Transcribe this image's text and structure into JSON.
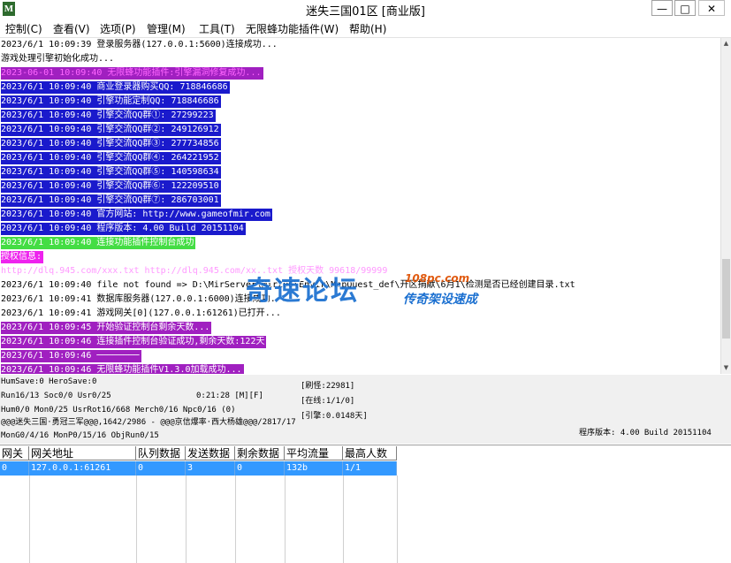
{
  "window": {
    "title": "迷失三国01区 [商业版]",
    "icon_char": "M",
    "minimize_label": "—",
    "maximize_label": "□",
    "close_label": "✕"
  },
  "menu": [
    {
      "label": "控制(C)"
    },
    {
      "label": "查看(V)"
    },
    {
      "label": "选项(P)"
    },
    {
      "label": "管理(M)"
    },
    {
      "label": "工具(T)"
    },
    {
      "label": "无限蜂功能插件(W)"
    },
    {
      "label": "帮助(H)"
    }
  ],
  "log": [
    {
      "text": "2023/6/1 10:09:39 登录服务器(127.0.0.1:5600)连接成功...",
      "color": "#000000",
      "bg": ""
    },
    {
      "text": "游戏处理引擎初始化成功...",
      "color": "#000000",
      "bg": ""
    },
    {
      "text": "2023-06-01 10:09:40 无限蜂功能插件:引擎漏洞修复成功...",
      "color": "#ff66ff",
      "bg": "#a020c0"
    },
    {
      "text": "2023/6/1 10:09:40 商业登录器购买QQ: 718846686",
      "color": "#ffffff",
      "bg": "#1a1acc"
    },
    {
      "text": "2023/6/1 10:09:40 引擎功能定制QQ: 718846686",
      "color": "#ffffff",
      "bg": "#1a1acc"
    },
    {
      "text": "2023/6/1 10:09:40 引擎交流QQ群①: 27299223",
      "color": "#ffffff",
      "bg": "#1a1acc"
    },
    {
      "text": "2023/6/1 10:09:40 引擎交流QQ群②: 249126912",
      "color": "#ffffff",
      "bg": "#1a1acc"
    },
    {
      "text": "2023/6/1 10:09:40 引擎交流QQ群③: 277734856",
      "color": "#ffffff",
      "bg": "#1a1acc"
    },
    {
      "text": "2023/6/1 10:09:40 引擎交流QQ群④: 264221952",
      "color": "#ffffff",
      "bg": "#1a1acc"
    },
    {
      "text": "2023/6/1 10:09:40 引擎交流QQ群⑤: 140598634",
      "color": "#ffffff",
      "bg": "#1a1acc"
    },
    {
      "text": "2023/6/1 10:09:40 引擎交流QQ群⑥: 122209510",
      "color": "#ffffff",
      "bg": "#1a1acc"
    },
    {
      "text": "2023/6/1 10:09:40 引擎交流QQ群⑦: 286703001",
      "color": "#ffffff",
      "bg": "#1a1acc"
    },
    {
      "text": "2023/6/1 10:09:40 官方网站: http://www.gameofmir.com",
      "color": "#ffffff",
      "bg": "#1a1acc"
    },
    {
      "text": "2023/6/1 10:09:40 程序版本: 4.00 Build 20151104",
      "color": "#ffffff",
      "bg": "#1a1acc"
    },
    {
      "text": "2023/6/1 10:09:40 连接功能插件控制台成功",
      "color": "#ffffff",
      "bg": "#44dd44"
    },
    {
      "text": "授权信息:",
      "color": "#ffffff",
      "bg": "#ee22ee"
    },
    {
      "text": "http://dlq.945.com/xxx.txt http://dlq.945.com/xx..txt 授权天数 99618/99999",
      "color": "#ff99ff",
      "bg": "#ffffff"
    },
    {
      "text": "2023/6/1 10:09:40 file not found => D:\\MirServer\\Mir200\\Envir\\MapQuest_def\\开区捐献\\6月1\\检测是否已经创建目录.txt",
      "color": "#000000",
      "bg": ""
    },
    {
      "text": "2023/6/1 10:09:41 数据库服务器(127.0.0.1:6000)连接成功...",
      "color": "#000000",
      "bg": ""
    },
    {
      "text": "2023/6/1 10:09:41 游戏网关[0](127.0.0.1:61261)已打开...",
      "color": "#000000",
      "bg": ""
    },
    {
      "text": "2023/6/1 10:09:45 开始验证控制台剩余天数...",
      "color": "#ffffff",
      "bg": "#a020c0"
    },
    {
      "text": "2023/6/1 10:09:46 连接插件控制台验证成功,剩余天数:122天",
      "color": "#ffffff",
      "bg": "#a020c0"
    },
    {
      "text": "2023/6/1 10:09:46 ────────",
      "color": "#ffffff",
      "bg": "#a020c0"
    },
    {
      "text": "2023/6/1 10:09:46 无限蜂功能插件V1.3.0加载成功...",
      "color": "#ffffff",
      "bg": "#a020c0"
    }
  ],
  "status": {
    "hum_save": "HumSave:0 HeroSave:0",
    "run": "Run16/13 Soc0/0 Usr0/25",
    "clock": "0:21:28 [M][F]",
    "brush": "[刷怪:22981]",
    "online": "[在线:1/1/0]",
    "engine": "[引擎:0.0148天]",
    "hum": "Hum0/0 Mon0/25 UsrRot16/668 Merch0/16 Npc0/16 (0)",
    "map": "@@@迷失三国·勇冠三军@@@,1642/2986 - @@@京信爆率·西大杨雄@@@/2817/17",
    "mon": "MonG0/4/16 MonP0/15/16 ObjRun0/15",
    "version": "程序版本: 4.00 Build 20151104"
  },
  "grid": {
    "columns": [
      "网关",
      "网关地址",
      "队列数据",
      "发送数据",
      "剩余数据",
      "平均流量",
      "最高人数"
    ],
    "rows": [
      [
        "0",
        "127.0.0.1:61261",
        "0",
        "3",
        "0",
        "132b",
        "1/1"
      ]
    ]
  },
  "watermark": {
    "main": "奇速论坛",
    "url": "108pc.com",
    "sub": "传奇架设速成"
  }
}
